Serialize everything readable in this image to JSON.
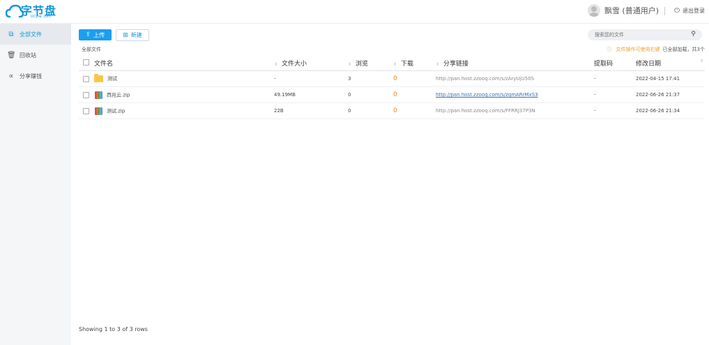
{
  "brand": {
    "name": "字节盘",
    "sub": "UCyiw. com"
  },
  "user": {
    "name": "飘雪 (普通用户)",
    "logout": "退出登录"
  },
  "sidebar": {
    "items": [
      {
        "label": "全部文件",
        "icon": "files-icon"
      },
      {
        "label": "回收站",
        "icon": "trash-icon"
      },
      {
        "label": "分享赚钱",
        "icon": "share-icon"
      }
    ]
  },
  "toolbar": {
    "upload": "上传",
    "new": "新建"
  },
  "search": {
    "placeholder": "搜索您的文件"
  },
  "breadcrumb": "全部文件",
  "hint": {
    "tip": "文件操作可使用右键",
    "status": "已全部加载，共3个"
  },
  "table": {
    "headers": [
      "文件名",
      "文件大小",
      "浏览",
      "下载",
      "分享链接",
      "提取码",
      "修改日期"
    ],
    "rows": [
      {
        "type": "folder",
        "name": "测试",
        "size": "-",
        "views": "3",
        "downloads": "0",
        "link": "http://pan.host.zzooq.com/s/zAryUjU50S",
        "code": "-",
        "date": "2022-04-15 17:41"
      },
      {
        "type": "zip",
        "name": "西兆云.zip",
        "size": "49.19MB",
        "views": "0",
        "downloads": "0",
        "link": "http://pan.host.zzooq.com/s/zqmARrMxS3",
        "code": "-",
        "date": "2022-06-26 21:37"
      },
      {
        "type": "zip",
        "name": "测试.zip",
        "size": "22B",
        "views": "0",
        "downloads": "0",
        "link": "http://pan.host.zzooq.com/s/FFRRJ37P3N",
        "code": "-",
        "date": "2022-06-26 21:34"
      }
    ]
  },
  "footer": "Showing 1 to 3 of 3 rows",
  "colors": {
    "accent": "#1a9ff0",
    "download": "#f37b1d",
    "warning": "#f0a020"
  }
}
